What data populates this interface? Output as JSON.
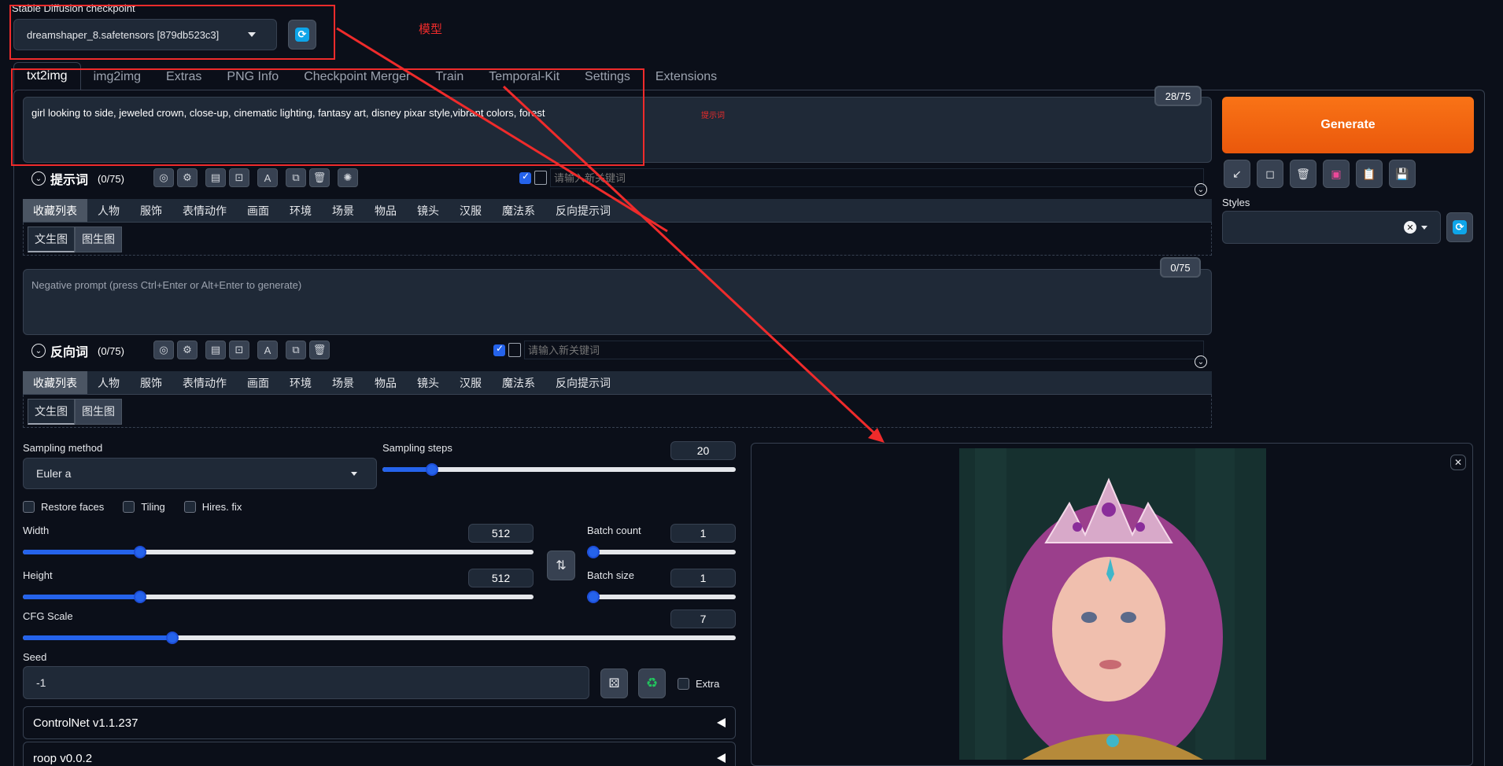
{
  "checkpoint": {
    "label": "Stable Diffusion checkpoint",
    "value": "dreamshaper_8.safetensors [879db523c3]"
  },
  "tabs": [
    "txt2img",
    "img2img",
    "Extras",
    "PNG Info",
    "Checkpoint Merger",
    "Train",
    "Temporal-Kit",
    "Settings",
    "Extensions"
  ],
  "prompt": {
    "text": "girl looking to side, jeweled crown, close-up, cinematic lighting, fantasy art, disney pixar style,vibrant colors, forest",
    "counter": "28/75",
    "helper_title": "提示词",
    "helper_count": "(0/75)",
    "keyword_placeholder": "请输入新关键词"
  },
  "negative": {
    "placeholder": "Negative prompt (press Ctrl+Enter or Alt+Enter to generate)",
    "counter": "0/75",
    "helper_title": "反向词",
    "helper_count": "(0/75)",
    "keyword_placeholder": "请输入新关键词"
  },
  "categories": [
    "收藏列表",
    "人物",
    "服饰",
    "表情动作",
    "画面",
    "环境",
    "场景",
    "物品",
    "镜头",
    "汉服",
    "魔法系",
    "反向提示词"
  ],
  "subtabs": [
    "文生图",
    "图生图"
  ],
  "generate": {
    "label": "Generate"
  },
  "styles": {
    "label": "Styles"
  },
  "sampling": {
    "method_label": "Sampling method",
    "method_value": "Euler a",
    "steps_label": "Sampling steps",
    "steps_value": "20",
    "steps_fraction": 0.14
  },
  "checks": {
    "restore_faces": "Restore faces",
    "tiling": "Tiling",
    "hires": "Hires. fix",
    "extra": "Extra"
  },
  "width": {
    "label": "Width",
    "value": "512",
    "fraction": 0.23
  },
  "height": {
    "label": "Height",
    "value": "512",
    "fraction": 0.23
  },
  "batch_count": {
    "label": "Batch count",
    "value": "1",
    "fraction": 0.0
  },
  "batch_size": {
    "label": "Batch size",
    "value": "1",
    "fraction": 0.0
  },
  "cfg": {
    "label": "CFG Scale",
    "value": "7",
    "fraction": 0.21
  },
  "seed": {
    "label": "Seed",
    "value": "-1"
  },
  "accordions": {
    "controlnet": "ControlNet v1.1.237",
    "roop": "roop v0.0.2"
  },
  "annotations": {
    "model": "模型",
    "prompt_hint": "提示词"
  },
  "colors": {
    "accent": "#2563eb",
    "generate": "#f97316",
    "annotation": "#ef2b2b",
    "background": "#0b0f19"
  }
}
